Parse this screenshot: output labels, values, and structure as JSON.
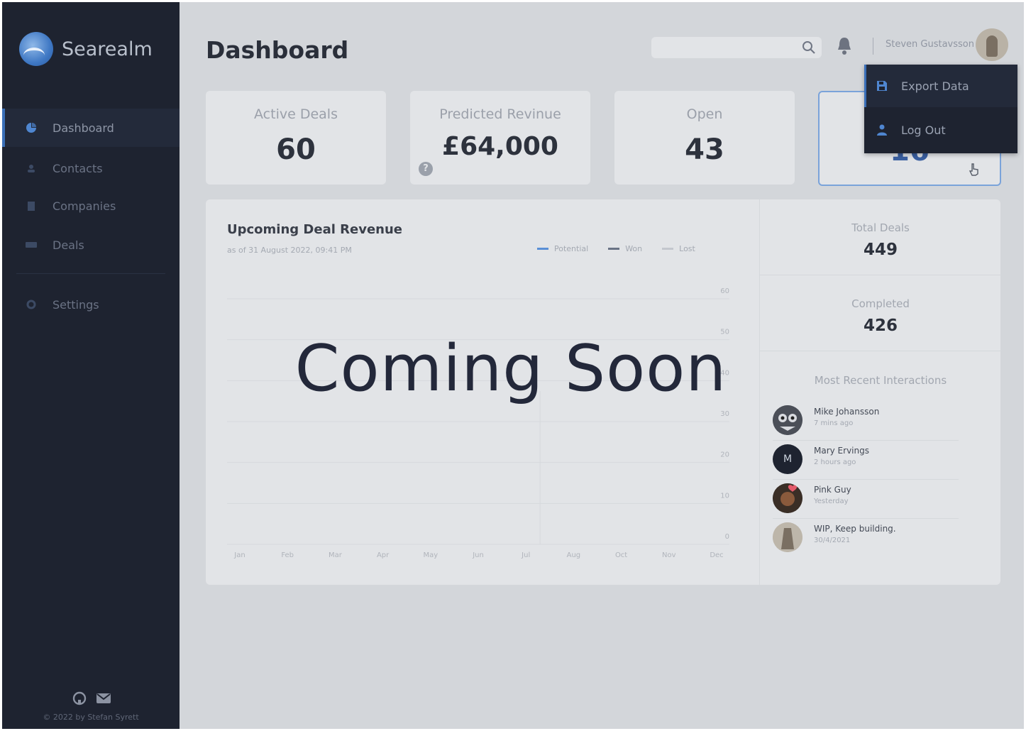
{
  "brand": {
    "name": "Searealm"
  },
  "sidebar": {
    "items": [
      {
        "label": "Dashboard",
        "icon": "pie-chart-icon",
        "active": true
      },
      {
        "label": "Contacts",
        "icon": "contacts-icon"
      },
      {
        "label": "Companies",
        "icon": "building-icon"
      },
      {
        "label": "Deals",
        "icon": "deals-icon"
      },
      {
        "label": "Settings",
        "icon": "gear-icon"
      }
    ],
    "footer_icons": [
      "github-icon",
      "mail-icon"
    ],
    "copyright": "© 2022 by Stefan Syrett"
  },
  "header": {
    "title": "Dashboard",
    "search": {
      "placeholder": "",
      "value": ""
    },
    "user_name": "Steven Gustavsson"
  },
  "kpis": [
    {
      "label": "Active Deals",
      "value": "60"
    },
    {
      "label": "Predicted Revinue",
      "value": "£64,000"
    },
    {
      "label": "Open",
      "value": "43"
    },
    {
      "label": "",
      "value": "16"
    }
  ],
  "user_menu": {
    "items": [
      {
        "label": "Export Data",
        "icon": "save-icon",
        "active": true
      },
      {
        "label": "Log Out",
        "icon": "user-icon"
      }
    ]
  },
  "revenue_chart": {
    "title": "Upcoming Deal Revenue",
    "subtitle": "as of 31 August 2022, 09:41 PM",
    "legend": [
      {
        "label": "Potential",
        "color": "#5a8fd6"
      },
      {
        "label": "Won",
        "color": "#6a7385"
      },
      {
        "label": "Lost",
        "color": "#c3c7ce"
      }
    ],
    "overlay_text": "Coming Soon"
  },
  "chart_data": {
    "type": "line",
    "title": "Upcoming Deal Revenue",
    "categories": [
      "Jan",
      "Feb",
      "Mar",
      "Apr",
      "May",
      "Jun",
      "Jul",
      "Aug",
      "Oct",
      "Nov",
      "Dec"
    ],
    "y_ticks": [
      "60",
      "50",
      "40",
      "30",
      "20",
      "10",
      "0"
    ],
    "ylim": [
      0,
      60
    ],
    "series": [
      {
        "name": "Potential",
        "values": []
      },
      {
        "name": "Won",
        "values": []
      },
      {
        "name": "Lost",
        "values": []
      }
    ],
    "grid": true,
    "legend_position": "top-right"
  },
  "stats": [
    {
      "label": "Total Deals",
      "value": "449"
    },
    {
      "label": "Completed",
      "value": "426"
    }
  ],
  "recent": {
    "title": "Most Recent Interactions",
    "items": [
      {
        "name": "Mike Johansson",
        "time": "7 mins ago"
      },
      {
        "name": "Mary Ervings",
        "time": "2 hours ago",
        "initial": "M"
      },
      {
        "name": "Pink Guy",
        "time": "Yesterday"
      },
      {
        "name": "WIP, Keep building.",
        "time": "30/4/2021"
      }
    ]
  }
}
